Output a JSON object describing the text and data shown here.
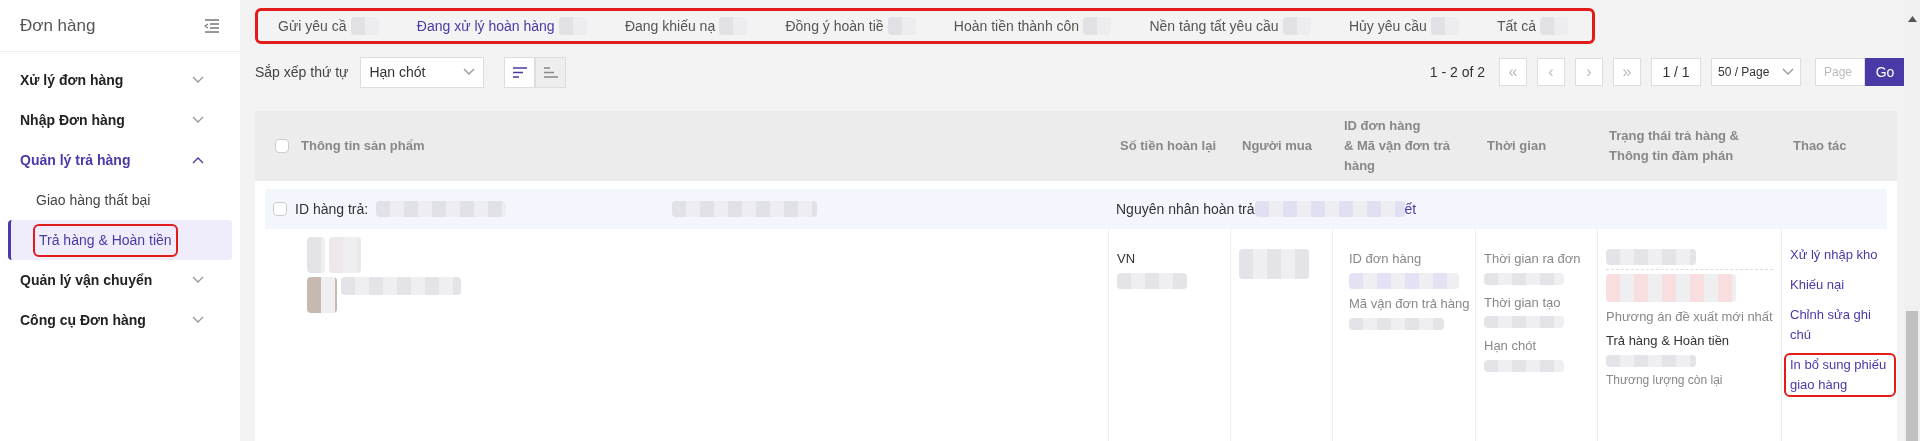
{
  "sidebar": {
    "title": "Đơn hàng",
    "groups": [
      {
        "label": "Xử lý đơn hàng",
        "expanded": false
      },
      {
        "label": "Nhập Đơn hàng",
        "expanded": false
      },
      {
        "label": "Quản lý trả hàng",
        "expanded": true,
        "children": [
          {
            "label": "Giao hàng thất bại",
            "selected": false,
            "highlighted": false
          },
          {
            "label": "Trả hàng & Hoàn tiền",
            "selected": true,
            "highlighted": true
          }
        ]
      },
      {
        "label": "Quản lý vận chuyển",
        "expanded": false
      },
      {
        "label": "Công cụ Đơn hàng",
        "expanded": false
      }
    ]
  },
  "tabs_highlighted": true,
  "tabs": [
    {
      "label": "Gửi yêu cầ",
      "selected": false
    },
    {
      "label": "Đang xử lý hoàn hàng",
      "selected": true
    },
    {
      "label": "Đang khiếu nạ",
      "selected": false
    },
    {
      "label": "Đồng ý hoàn tiề",
      "selected": false
    },
    {
      "label": "Hoàn tiền thành côn",
      "selected": false
    },
    {
      "label": "Nền tảng tất yêu cầu",
      "selected": false
    },
    {
      "label": "Hủy yêu cầu",
      "selected": false
    },
    {
      "label": "Tất cả",
      "selected": false
    }
  ],
  "sort": {
    "label": "Sắp xếp thứ tự",
    "value": "Hạn chót",
    "descending": true
  },
  "pagination": {
    "range": "1 - 2 of 2",
    "first": "«",
    "prev": "‹",
    "next": "›",
    "last": "»",
    "page": "1 / 1",
    "page_size": "50 / Page",
    "page_placeholder": "Page",
    "go": "Go"
  },
  "table": {
    "columns": [
      "Thông tin sản phẩm",
      "Số tiền hoàn lại",
      "Người mua",
      "ID đơn hàng\n& Mã vận đơn trả hàng",
      "Thời gian",
      "Trạng thái trả hàng & Thông tin đàm phán",
      "Thao tác"
    ],
    "select_all_checked": false,
    "row": {
      "checked": false,
      "id_label": "ID hàng trả:",
      "reason_label": "Nguyên nhân hoàn trả",
      "reason_tail": "ết",
      "amount": "VN",
      "order_labels": [
        "ID đơn hàng",
        "Mã vận đơn trả hàng"
      ],
      "time_labels": [
        "Thời gian ra đơn",
        "Thời gian tạo",
        "Hạn chót"
      ],
      "status": {
        "proposal_label": "Phương án đề xuất mới nhất",
        "proposal": "Trả hàng & Hoàn tiền",
        "remaining": "Thương lượng còn lại"
      },
      "actions": [
        {
          "label": "Xử lý nhập kho",
          "highlighted": false
        },
        {
          "label": "Khiếu nại",
          "highlighted": false
        },
        {
          "label": "Chỉnh sửa ghi chú",
          "highlighted": false
        },
        {
          "label": "In bổ sung phiếu giao hàng",
          "highlighted": true
        }
      ]
    }
  }
}
